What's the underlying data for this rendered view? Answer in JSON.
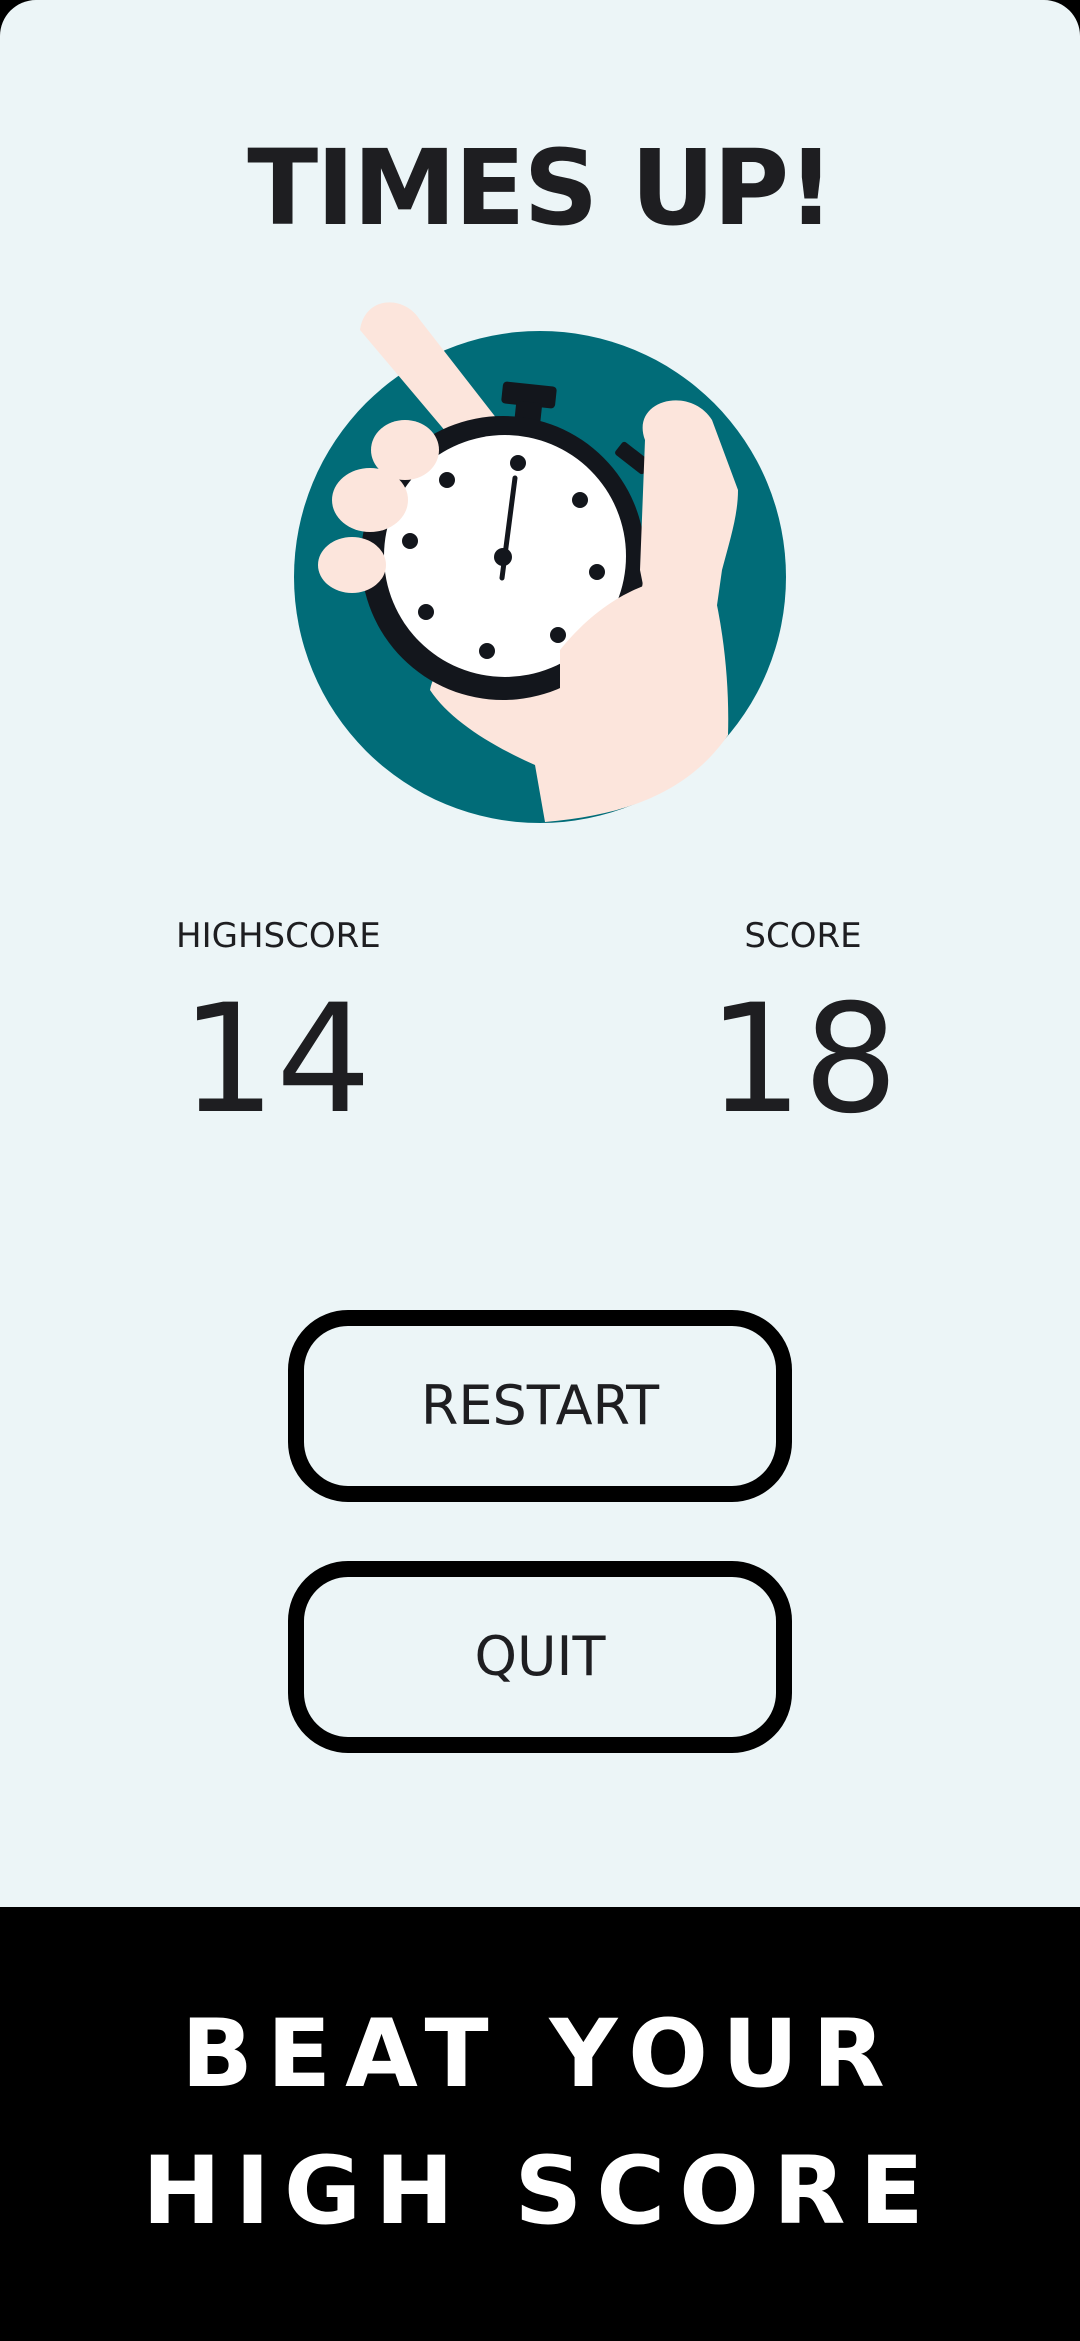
{
  "game_over": {
    "title": "TIMES UP!",
    "illustration": "stopwatch-in-hand-icon",
    "highscore_label": "HIGHSCORE",
    "highscore_value": "14",
    "score_label": "SCORE",
    "score_value": "18",
    "restart_label": "RESTART",
    "quit_label": "QUIT"
  },
  "banner": {
    "line1": "BEAT YOUR",
    "line2": "HIGH SCORE"
  },
  "colors": {
    "background": "#ECF5F7",
    "text": "#1E1E21",
    "circle_teal": "#016C78",
    "hand_skin": "#FCE5DC",
    "banner_bg": "#000000",
    "banner_text": "#FFFFFF"
  }
}
